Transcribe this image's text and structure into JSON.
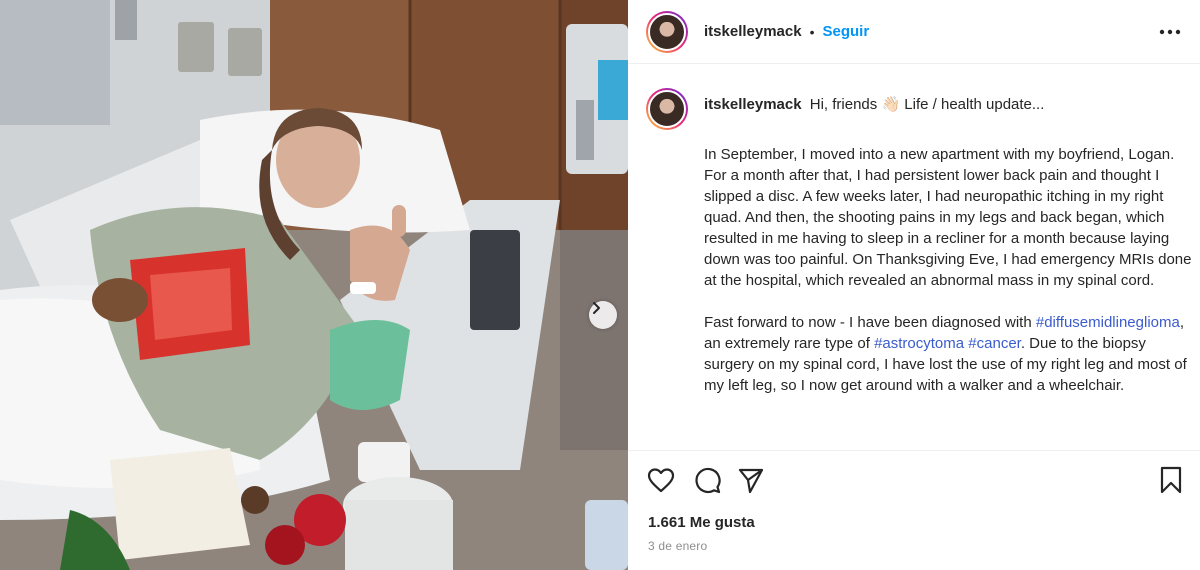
{
  "photo": {
    "alt_semantic": "hospital-photo",
    "next_icon": "chevron-right-icon"
  },
  "header": {
    "username": "itskelleymack",
    "separator": "•",
    "follow_label": "Seguir",
    "more_icon": "more-options-icon"
  },
  "caption": {
    "username": "itskelleymack",
    "first_line": "Hi, friends 👋🏻 Life / health update...",
    "paragraph1": "In September, I moved into a new apartment with my boyfriend, Logan. For a month after that, I had persistent lower back pain and thought I slipped a disc. A few weeks later, I had neuropathic itching in my right quad. And then, the shooting pains in my legs and back began, which resulted in me having to sleep in a recliner for a month because laying down was too painful. On Thanksgiving Eve, I had emergency MRIs done at the hospital, which revealed an abnormal mass in my spinal cord.",
    "p2_text1": "Fast forward to now - I have been diagnosed with ",
    "p2_tag1": "#diffusemidlineglioma",
    "p2_text2": ", an extremely rare type of ",
    "p2_tag2": "#astrocytoma",
    "p2_text3": " ",
    "p2_tag3": "#cancer",
    "p2_text4": ". Due to the biopsy surgery on my spinal cord, I have lost the use of my right leg and most of my left leg, so I now get around with a walker and a wheelchair."
  },
  "actions": {
    "like_icon": "heart-icon",
    "comment_icon": "comment-icon",
    "share_icon": "share-icon",
    "save_icon": "bookmark-icon"
  },
  "likes_text": "1.661 Me gusta",
  "date_text": "3 de enero",
  "colors": {
    "link_blue": "#0095f6",
    "hashtag": "#3b5ccc",
    "text": "#262626",
    "muted": "#8e8e8e"
  }
}
